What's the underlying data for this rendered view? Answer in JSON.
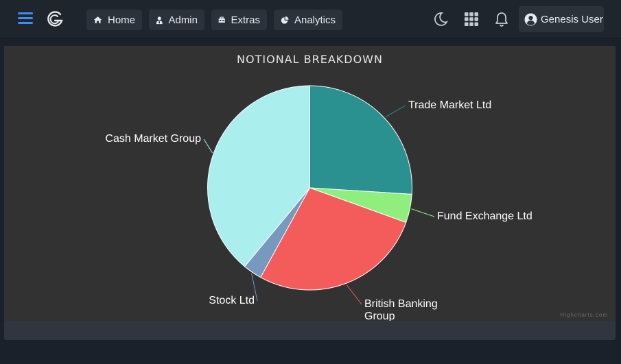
{
  "header": {
    "nav": [
      {
        "label": "Home",
        "icon": "home-icon"
      },
      {
        "label": "Admin",
        "icon": "user-tie-icon"
      },
      {
        "label": "Extras",
        "icon": "toolbox-icon"
      },
      {
        "label": "Analytics",
        "icon": "pie-chart-icon"
      }
    ],
    "user_label": "Genesis User",
    "icons": [
      "menu-icon",
      "genesis-logo",
      "moon-icon",
      "apps-grid-icon",
      "bell-icon",
      "user-circle-icon"
    ]
  },
  "chart_data": {
    "type": "pie",
    "title": "NOTIONAL BREAKDOWN",
    "credits": "Highcharts.com",
    "slices": [
      {
        "name": "Trade Market Ltd",
        "value": 26,
        "color": "#2a9090"
      },
      {
        "name": "Fund Exchange Ltd",
        "value": 4.5,
        "color": "#90ee7e"
      },
      {
        "name": "British Banking Group",
        "value": 27.5,
        "color": "#f45b5b"
      },
      {
        "name": "Stock Ltd",
        "value": 3,
        "color": "#7798bf"
      },
      {
        "name": "Cash Market Group",
        "value": 39,
        "color": "#aaeeee"
      }
    ]
  }
}
